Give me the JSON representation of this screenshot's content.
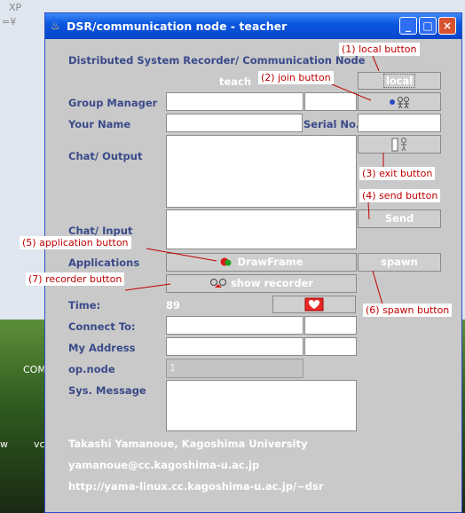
{
  "window": {
    "title": "DSR/communication node - teacher",
    "minimize_glyph": "_",
    "maximize_glyph": "□",
    "close_glyph": "×"
  },
  "desktop": {
    "top_left_1": "XP",
    "top_left_2": "=¥",
    "com_label": "COM",
    "w_label": "w",
    "vc_label": "vc"
  },
  "header": "Distributed System Recorder/ Communication Node",
  "role_label": "teach",
  "buttons": {
    "local": "local",
    "send": "Send",
    "spawn": "spawn",
    "drawframe": "DrawFrame",
    "show_recorder": "show recorder"
  },
  "labels": {
    "group_manager": "Group Manager",
    "your_name": "Your Name",
    "serial_no": "Serial No.",
    "chat_output": "Chat/ Output",
    "chat_input": "Chat/ Input",
    "applications": "Applications",
    "time": "Time:",
    "connect_to": "Connect To:",
    "my_address": "My Address",
    "op_node": "op.node",
    "sys_message": "Sys. Message"
  },
  "values": {
    "time": "89",
    "op_node": "1"
  },
  "footer": {
    "author": "Takashi Yamanoue, Kagoshima University",
    "email": "yamanoue@cc.kagoshima-u.ac.jp",
    "url": "http://yama-linux.cc.kagoshima-u.ac.jp/~dsr"
  },
  "annotations": {
    "local": "(1) local button",
    "join": "(2) join button",
    "exit": "(3) exit button",
    "send": "(4) send button",
    "application": "(5) application button",
    "spawn": "(6) spawn button",
    "recorder": "(7) recorder button"
  },
  "icons": {
    "title": "java-cup-icon",
    "join": "join-people-icon",
    "exit": "exit-door-icon",
    "heart": "heart-icon",
    "drawframe": "drawframe-icon",
    "recorder": "recorder-icon"
  }
}
